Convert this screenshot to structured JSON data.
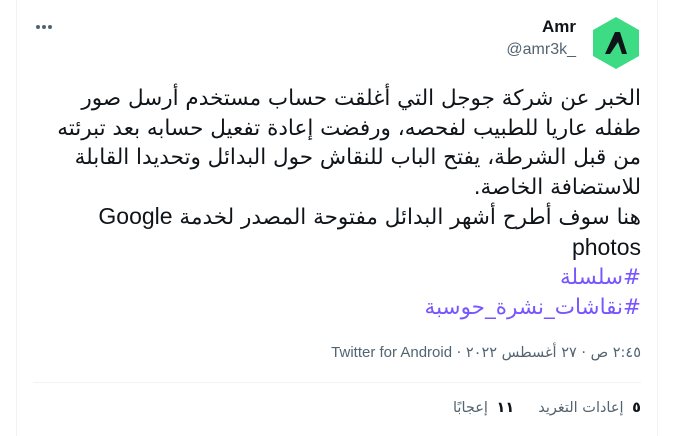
{
  "author": {
    "name": "Amr",
    "handle": "@amr3k_",
    "avatar_color": "#3ddc84"
  },
  "tweet": {
    "text_lines": [
      "الخبر عن شركة جوجل التي أغلقت حساب مستخدم أرسل صور طفله عاريا للطبيب لفحصه، ورفضت إعادة تفعيل حسابه بعد تبرئته من قبل الشرطة، يفتح الباب للنقاش حول البدائل وتحديدا القابلة للاستضافة الخاصة."
    ],
    "line2_prefix": "هنا سوف أطرح أشهر البدائل مفتوحة المصدر لخدمة",
    "line2_brand": "Google photos",
    "hashtags": [
      "#سلسلة",
      "#نقاشات_نشرة_حوسبة"
    ],
    "hashtag_color": "#7856ff"
  },
  "meta": {
    "time": "٢:٤٥ ص",
    "date": "٢٧ أغسطس ٢٠٢٢",
    "separator": "·",
    "source": "Twitter for Android"
  },
  "stats": {
    "retweets_count": "٥",
    "retweets_label": "إعادات التغريد",
    "likes_count": "١١",
    "likes_label": "إعجابًا"
  }
}
